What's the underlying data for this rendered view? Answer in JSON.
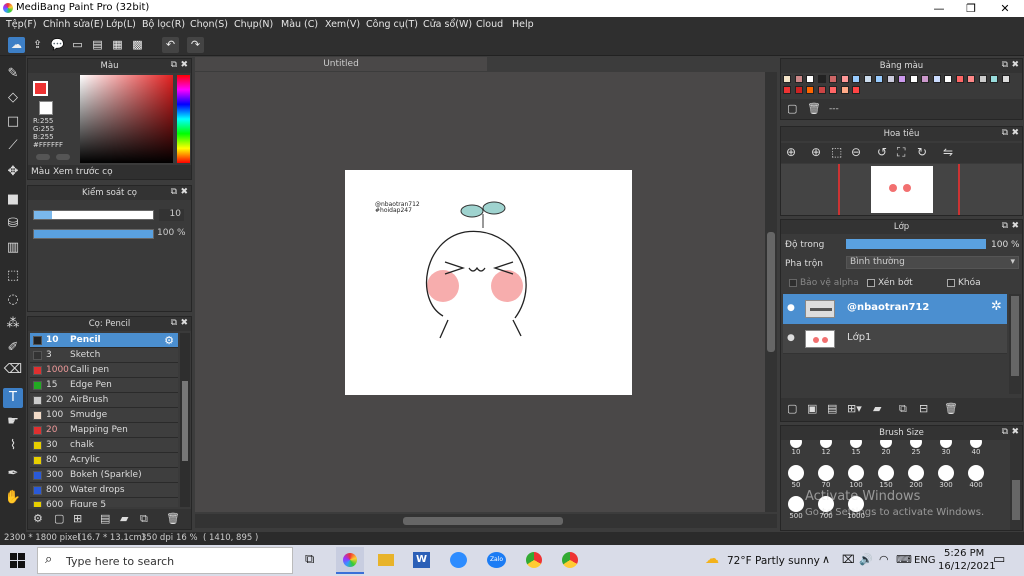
{
  "window": {
    "title": "MediBang Paint Pro (32bit)",
    "minimize": "—",
    "restore": "❐",
    "close": "✕"
  },
  "menu": [
    "Tệp(F)",
    "Chỉnh sửa(E)",
    "Lớp(L)",
    "Bộ lọc(R)",
    "Chọn(S)",
    "Chụp(N)",
    "Màu (C)",
    "Xem(V)",
    "Công cụ(T)",
    "Cửa sổ(W)",
    "Cloud",
    "Help"
  ],
  "color_panel": {
    "title": "Màu",
    "r": "R:255",
    "g": "G:255",
    "b": "B:255",
    "hex": "#FFFFFF",
    "tab_color": "Màu",
    "tab_preview": "Xem trước cọ"
  },
  "brush_control": {
    "title": "Kiểm soát cọ",
    "size": "10",
    "opacity": "100 %",
    "size_fill": 0.15,
    "opacity_fill": 1.0
  },
  "brush_panel": {
    "title": "Cọ: Pencil",
    "items": [
      {
        "size": "10",
        "name": "Pencil",
        "color": "#222222",
        "selected": true
      },
      {
        "size": "3",
        "name": "Sketch",
        "color": "#333333"
      },
      {
        "size": "1000",
        "name": "Calli pen",
        "color": "#e03030"
      },
      {
        "size": "15",
        "name": "Edge Pen",
        "color": "#22aa22"
      },
      {
        "size": "200",
        "name": "AirBrush",
        "color": "#cccccc"
      },
      {
        "size": "100",
        "name": "Smudge",
        "color": "#f3dcc8"
      },
      {
        "size": "20",
        "name": "Mapping Pen",
        "color": "#e03030"
      },
      {
        "size": "30",
        "name": "chalk",
        "color": "#e8d000"
      },
      {
        "size": "80",
        "name": "Acrylic",
        "color": "#e8d000"
      },
      {
        "size": "300",
        "name": "Bokeh (Sparkle)",
        "color": "#2a5ad8"
      },
      {
        "size": "800",
        "name": "Water drops",
        "color": "#2a5ad8"
      },
      {
        "size": "600",
        "name": "Figure 5",
        "color": "#e8d000"
      }
    ]
  },
  "canvas": {
    "tab": "Untitled",
    "drawing_text1": "@nbaotran712",
    "drawing_text2": "#hoidap247"
  },
  "palette": {
    "title": "Bảng màu",
    "row1": [
      "#f4e4c8",
      "#c88",
      "#fff",
      "#222",
      "#c66",
      "#f99",
      "#9cf",
      "#cde",
      "#9cf",
      "#ccd",
      "#c9e",
      "#fff",
      "#c9c",
      "#cdf",
      "#fff",
      "#f66",
      "#f88",
      "#ccc",
      "#9dd",
      "#ddd"
    ],
    "row2": [
      "#e33",
      "#c22",
      "#f60",
      "#c44",
      "#f66",
      "#fa8",
      "#f44"
    ],
    "placeholder": "---"
  },
  "navigator": {
    "title": "Hoa tiêu"
  },
  "layers": {
    "title": "Lớp",
    "opacity_label": "Độ trong",
    "opacity_value": "100 %",
    "opacity_fill": 1.0,
    "blend_label": "Pha trộn",
    "blend_value": "Bình thường",
    "protect_alpha": "Bảo vệ alpha",
    "clipping": "Xén bớt",
    "lock": "Khóa",
    "items": [
      {
        "name": "@nbaotran712",
        "selected": true
      },
      {
        "name": "Lớp1",
        "selected": false
      }
    ]
  },
  "brush_size": {
    "title": "Brush Size",
    "sizes": [
      "10",
      "12",
      "15",
      "20",
      "25",
      "30",
      "40",
      "50",
      "70",
      "100",
      "150",
      "200",
      "300",
      "400",
      "500",
      "700",
      "1000"
    ]
  },
  "status": {
    "dims": "2300 * 1800 pixel",
    "cm": "(16.7 * 13.1cm)",
    "dpi": "350 dpi",
    "zoom": "16 %",
    "coords": "( 1410, 895 )"
  },
  "watermark": {
    "line1": "Activate Windows",
    "line2": "Go to Settings to activate Windows."
  },
  "taskbar": {
    "search": "Type here to search",
    "weather": "72°F  Partly sunny",
    "lang": "ENG",
    "time": "5:26 PM",
    "date": "16/12/2021"
  }
}
